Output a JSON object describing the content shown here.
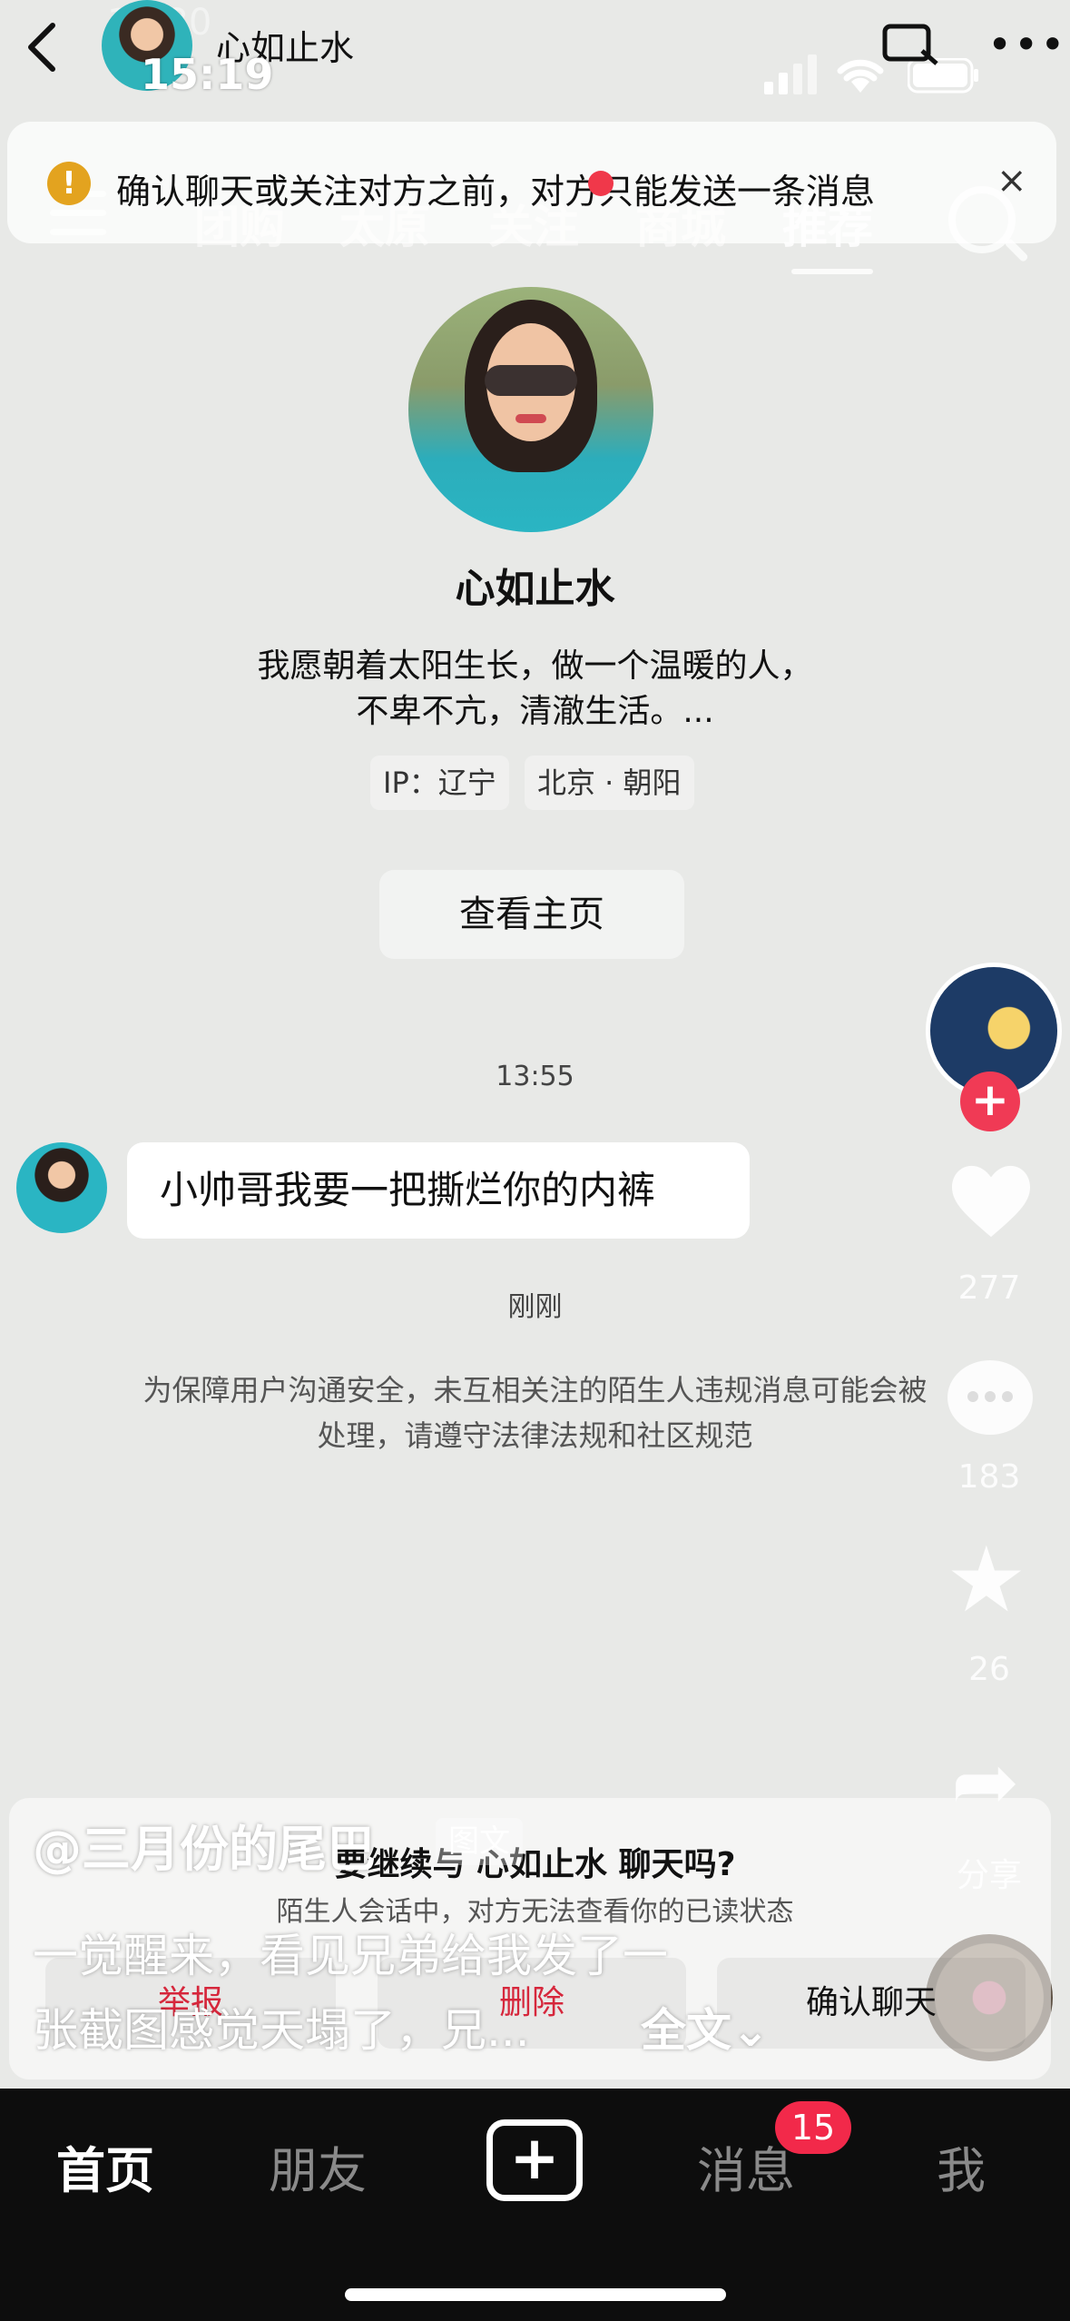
{
  "status_bar": {
    "time": "15:19",
    "time_ghost": "13:30"
  },
  "header": {
    "contact_name": "心如止水",
    "more_label": "•••"
  },
  "notice": {
    "text": "确认聊天或关注对方之前，对方只能发送一条消息",
    "close_label": "×"
  },
  "video_nav": {
    "tabs": [
      "团购",
      "太原",
      "关注",
      "商城",
      "推荐"
    ]
  },
  "profile": {
    "name": "心如止水",
    "bio_line1": "我愿朝着太阳生长，做一个温暖的人，",
    "bio_line2": "不卑不亢，清澈生活。...",
    "ip_tag": "IP：辽宁",
    "location_tag": "北京 · 朝阳",
    "view_home_label": "查看主页"
  },
  "chat": {
    "time_1": "13:55",
    "message": "小帅哥我要一把撕烂你的内裤",
    "time_2": "刚刚",
    "safety_line1": "为保障用户沟通安全，未互相关注的陌生人违规消息可能会被",
    "safety_line2": "处理，请遵守法律法规和社区规范"
  },
  "sheet": {
    "title": "要继续与 心如止水 聊天吗?",
    "subtitle": "陌生人会话中，对方无法查看你的已读状态",
    "report_label": "举报",
    "delete_label": "删除",
    "confirm_label": "确认聊天"
  },
  "video": {
    "author": "@三月份的尾巴",
    "type_tag": "图文",
    "caption_line1": "一觉醒来，看见兄弟给我发了一",
    "caption_line2": "张截图感觉天塌了，兄...",
    "fulltext_label": "全文⌄",
    "like_count": "277",
    "comment_count": "183",
    "favorite_count": "26",
    "share_label": "分享"
  },
  "tabbar": {
    "home": "首页",
    "friends": "朋友",
    "create": "+",
    "messages": "消息",
    "messages_badge": "15",
    "me": "我"
  }
}
